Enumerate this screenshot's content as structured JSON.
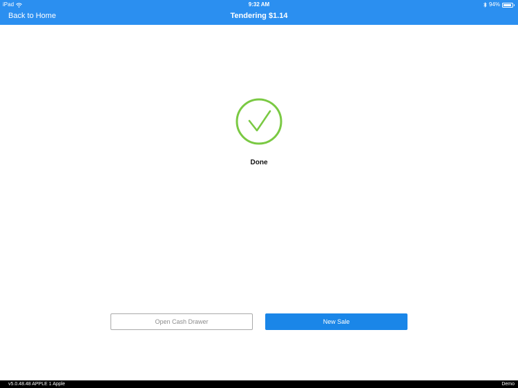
{
  "status_bar": {
    "device": "iPad",
    "time": "9:32 AM",
    "battery": "94%",
    "battery_level": 0.94,
    "icons": [
      "wifi-icon",
      "bluetooth-icon",
      "battery-icon"
    ]
  },
  "nav": {
    "back_label": "Back to Home",
    "title": "Tendering $1.14"
  },
  "status": {
    "label": "Done",
    "icon": "checkmark-circle-icon",
    "accent_color": "#7ac943"
  },
  "actions": {
    "open_drawer_label": "Open Cash Drawer",
    "new_sale_label": "New Sale"
  },
  "footer": {
    "version": "v5.0.48.48  APPLE 1  Apple",
    "mode": "Demo"
  },
  "colors": {
    "header": "#2b8ff0",
    "primary_button": "#1a86e8",
    "footer": "#000000"
  }
}
